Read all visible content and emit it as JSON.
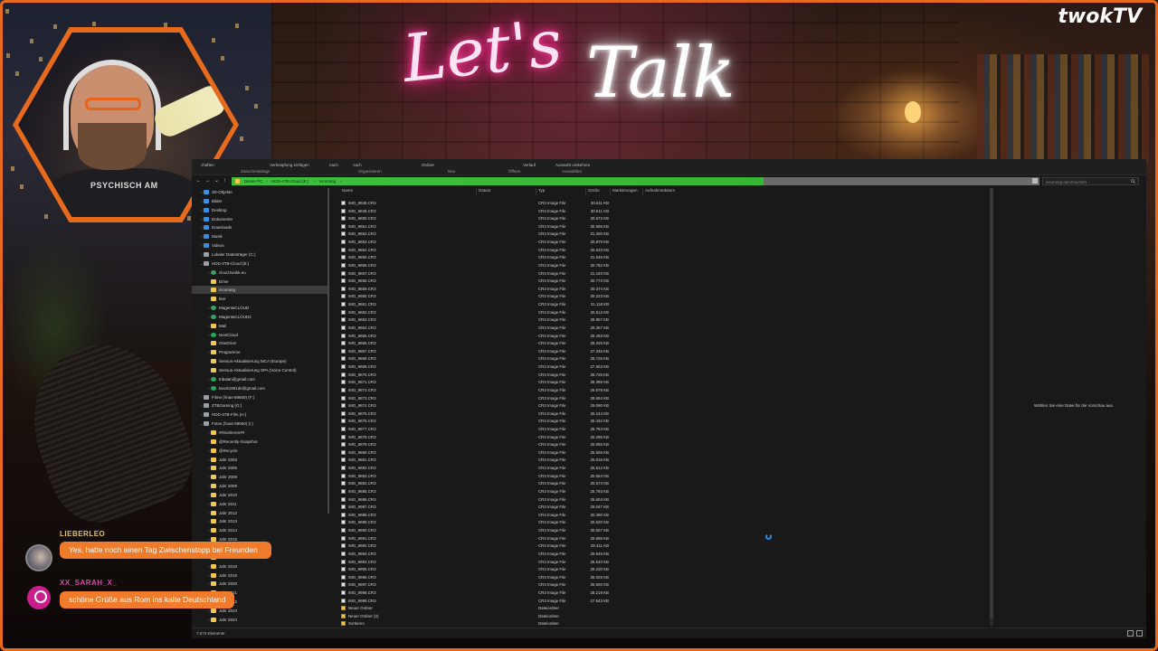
{
  "overlay": {
    "lets": "Let's",
    "talk": "Talk",
    "logo": "twokTV",
    "shirt_text": "PSYCHISCH AM"
  },
  "ribbon": {
    "items": [
      "chaften",
      "Verknüpfung einfügen",
      "nach",
      "nach",
      "Ordner",
      "Verlauf",
      "Auswahl umkehren"
    ],
    "groups": [
      "Zwischenablage",
      "Organisieren",
      "Neu",
      "Öffnen",
      "Auswählen"
    ]
  },
  "address": {
    "segments": [
      "Dieser PC",
      "HDD-4TB-Cloud (E:)",
      "incoming"
    ],
    "search_placeholder": "incoming durchsuchen"
  },
  "tree": [
    {
      "label": "3D-Objekte",
      "icon": "blue",
      "arrow": "›",
      "indent": 0
    },
    {
      "label": "Bilder",
      "icon": "blue",
      "arrow": "›",
      "indent": 0
    },
    {
      "label": "Desktop",
      "icon": "blue",
      "arrow": "›",
      "indent": 0
    },
    {
      "label": "Dokumente",
      "icon": "blue",
      "arrow": "›",
      "indent": 0
    },
    {
      "label": "Downloads",
      "icon": "blue",
      "arrow": "›",
      "indent": 0
    },
    {
      "label": "Musik",
      "icon": "blue",
      "arrow": "›",
      "indent": 0
    },
    {
      "label": "Videos",
      "icon": "blue",
      "arrow": "›",
      "indent": 0
    },
    {
      "label": "Lokaler Datenträger (C:)",
      "icon": "drive",
      "arrow": "›",
      "indent": 0
    },
    {
      "label": "HDD-4TB-Cloud (E:)",
      "icon": "drive",
      "arrow": "⌄",
      "indent": 0
    },
    {
      "label": "cloud.twokk.eu",
      "icon": "cloud",
      "arrow": "›",
      "indent": 1
    },
    {
      "label": "Drive",
      "icon": "folder",
      "arrow": "",
      "indent": 1
    },
    {
      "label": "incoming",
      "icon": "folder",
      "arrow": "",
      "indent": 1,
      "selected": true
    },
    {
      "label": "leer",
      "icon": "folder",
      "arrow": "",
      "indent": 1
    },
    {
      "label": "MagentaCLOUD",
      "icon": "cloud",
      "arrow": "›",
      "indent": 1
    },
    {
      "label": "MagentaCLOUD2",
      "icon": "cloud",
      "arrow": "›",
      "indent": 1
    },
    {
      "label": "Mail",
      "icon": "folder",
      "arrow": "›",
      "indent": 1
    },
    {
      "label": "NextCloud",
      "icon": "green",
      "arrow": "›",
      "indent": 1
    },
    {
      "label": "OneDrive",
      "icon": "folder",
      "arrow": "",
      "indent": 1
    },
    {
      "label": "Programme",
      "icon": "folder",
      "arrow": "›",
      "indent": 1
    },
    {
      "label": "Sensus-Aktualisierung MCA (Europe)",
      "icon": "folder",
      "arrow": "",
      "indent": 1
    },
    {
      "label": "Sensus-Aktualisierung SPA (Voice Control)",
      "icon": "folder",
      "arrow": "",
      "indent": 1
    },
    {
      "label": "tribalan@gmail.com",
      "icon": "green",
      "arrow": "›",
      "indent": 1
    },
    {
      "label": "tavok1981de@gmail.com",
      "icon": "green",
      "arrow": "›",
      "indent": 1
    },
    {
      "label": "Filme (\\\\nas-59650) (F:)",
      "icon": "drive",
      "arrow": "›",
      "indent": 0
    },
    {
      "label": "ZTBGaming (G:)",
      "icon": "drive",
      "arrow": "›",
      "indent": 0
    },
    {
      "label": "HDD-4TB-Film (H:)",
      "icon": "drive",
      "arrow": "›",
      "indent": 0
    },
    {
      "label": "Fotos (\\\\nas-59650) (I:)",
      "icon": "drive",
      "arrow": "⌄",
      "indent": 0
    },
    {
      "label": "##Sortieren##",
      "icon": "folder",
      "arrow": "›",
      "indent": 1
    },
    {
      "label": "@Recently-Snapshot",
      "icon": "folder",
      "arrow": "›",
      "indent": 1
    },
    {
      "label": "@Recycle",
      "icon": "folder",
      "arrow": "›",
      "indent": 1
    },
    {
      "label": "Jahr 2003",
      "icon": "folder",
      "arrow": "›",
      "indent": 1
    },
    {
      "label": "Jahr 2005",
      "icon": "folder",
      "arrow": "›",
      "indent": 1
    },
    {
      "label": "Jahr 2008",
      "icon": "folder",
      "arrow": "›",
      "indent": 1
    },
    {
      "label": "Jahr 2009",
      "icon": "folder",
      "arrow": "›",
      "indent": 1
    },
    {
      "label": "Jahr 2010",
      "icon": "folder",
      "arrow": "›",
      "indent": 1
    },
    {
      "label": "Jahr 2011",
      "icon": "folder",
      "arrow": "›",
      "indent": 1
    },
    {
      "label": "Jahr 2012",
      "icon": "folder",
      "arrow": "›",
      "indent": 1
    },
    {
      "label": "Jahr 2013",
      "icon": "folder",
      "arrow": "›",
      "indent": 1
    },
    {
      "label": "Jahr 2014",
      "icon": "folder",
      "arrow": "›",
      "indent": 1
    },
    {
      "label": "Jahr 2015",
      "icon": "folder",
      "arrow": "›",
      "indent": 1
    },
    {
      "label": "Jahr 2016",
      "icon": "folder",
      "arrow": "›",
      "indent": 1
    },
    {
      "label": "Jahr 2017",
      "icon": "folder",
      "arrow": "›",
      "indent": 1
    },
    {
      "label": "Jahr 2018",
      "icon": "folder",
      "arrow": "›",
      "indent": 1
    },
    {
      "label": "Jahr 2019",
      "icon": "folder",
      "arrow": "›",
      "indent": 1
    },
    {
      "label": "Jahr 2020",
      "icon": "folder",
      "arrow": "›",
      "indent": 1
    },
    {
      "label": "Jahr 2021",
      "icon": "folder",
      "arrow": "›",
      "indent": 1
    },
    {
      "label": "Jahr 2022",
      "icon": "folder",
      "arrow": "›",
      "indent": 1
    },
    {
      "label": "Jahr 2023",
      "icon": "folder",
      "arrow": "›",
      "indent": 1
    },
    {
      "label": "Jahr 2024",
      "icon": "folder",
      "arrow": "›",
      "indent": 1
    }
  ],
  "columns": [
    "Name",
    "Datum",
    "Typ",
    "Größe",
    "Markierungen",
    "Aufnahmedatum"
  ],
  "files": [
    {
      "name": "IMG_9848.CR3",
      "type": "CR3 Image File",
      "size": "30.511 KB"
    },
    {
      "name": "IMG_9849.CR3",
      "type": "CR3 Image File",
      "size": "30.611 KB"
    },
    {
      "name": "IMG_9850.CR3",
      "type": "CR3 Image File",
      "size": "30.573 KB"
    },
    {
      "name": "IMG_9851.CR3",
      "type": "CR3 Image File",
      "size": "30.595 KB"
    },
    {
      "name": "IMG_9852.CR3",
      "type": "CR3 Image File",
      "size": "31.250 KB"
    },
    {
      "name": "IMG_9853.CR3",
      "type": "CR3 Image File",
      "size": "30.879 KB"
    },
    {
      "name": "IMG_9854.CR3",
      "type": "CR3 Image File",
      "size": "30.633 KB"
    },
    {
      "name": "IMG_9855.CR3",
      "type": "CR3 Image File",
      "size": "31.548 KB"
    },
    {
      "name": "IMG_9856.CR3",
      "type": "CR3 Image File",
      "size": "30.782 KB"
    },
    {
      "name": "IMG_9857.CR3",
      "type": "CR3 Image File",
      "size": "31.193 KB"
    },
    {
      "name": "IMG_9858.CR3",
      "type": "CR3 Image File",
      "size": "30.773 KB"
    },
    {
      "name": "IMG_9859.CR3",
      "type": "CR3 Image File",
      "size": "30.374 KB"
    },
    {
      "name": "IMG_9860.CR3",
      "type": "CR3 Image File",
      "size": "30.223 KB"
    },
    {
      "name": "IMG_9861.CR3",
      "type": "CR3 Image File",
      "size": "31.118 KB"
    },
    {
      "name": "IMG_9862.CR3",
      "type": "CR3 Image File",
      "size": "30.513 KB"
    },
    {
      "name": "IMG_9863.CR3",
      "type": "CR3 Image File",
      "size": "28.857 KB"
    },
    {
      "name": "IMG_9864.CR3",
      "type": "CR3 Image File",
      "size": "29.367 KB"
    },
    {
      "name": "IMG_9865.CR3",
      "type": "CR3 Image File",
      "size": "28.493 KB"
    },
    {
      "name": "IMG_9866.CR3",
      "type": "CR3 Image File",
      "size": "28.345 KB"
    },
    {
      "name": "IMG_9867.CR3",
      "type": "CR3 Image File",
      "size": "27.345 KB"
    },
    {
      "name": "IMG_9868.CR3",
      "type": "CR3 Image File",
      "size": "28.725 KB"
    },
    {
      "name": "IMG_9869.CR3",
      "type": "CR3 Image File",
      "size": "27.553 KB"
    },
    {
      "name": "IMG_9870.CR3",
      "type": "CR3 Image File",
      "size": "28.726 KB"
    },
    {
      "name": "IMG_9871.CR3",
      "type": "CR3 Image File",
      "size": "28.399 KB"
    },
    {
      "name": "IMG_9872.CR3",
      "type": "CR3 Image File",
      "size": "26.678 KB"
    },
    {
      "name": "IMG_9873.CR3",
      "type": "CR3 Image File",
      "size": "28.654 KB"
    },
    {
      "name": "IMG_9874.CR3",
      "type": "CR3 Image File",
      "size": "29.090 KB"
    },
    {
      "name": "IMG_9875.CR3",
      "type": "CR3 Image File",
      "size": "28.244 KB"
    },
    {
      "name": "IMG_9876.CR3",
      "type": "CR3 Image File",
      "size": "28.432 KB"
    },
    {
      "name": "IMG_9877.CR3",
      "type": "CR3 Image File",
      "size": "25.784 KB"
    },
    {
      "name": "IMG_9878.CR3",
      "type": "CR3 Image File",
      "size": "26.295 KB"
    },
    {
      "name": "IMG_9879.CR3",
      "type": "CR3 Image File",
      "size": "26.055 KB"
    },
    {
      "name": "IMG_9880.CR3",
      "type": "CR3 Image File",
      "size": "25.608 KB"
    },
    {
      "name": "IMG_9881.CR3",
      "type": "CR3 Image File",
      "size": "26.018 KB"
    },
    {
      "name": "IMG_9882.CR3",
      "type": "CR3 Image File",
      "size": "25.612 KB"
    },
    {
      "name": "IMG_9883.CR3",
      "type": "CR3 Image File",
      "size": "25.554 KB"
    },
    {
      "name": "IMG_9884.CR3",
      "type": "CR3 Image File",
      "size": "25.574 KB"
    },
    {
      "name": "IMG_9885.CR3",
      "type": "CR3 Image File",
      "size": "25.793 KB"
    },
    {
      "name": "IMG_9886.CR3",
      "type": "CR3 Image File",
      "size": "25.604 KB"
    },
    {
      "name": "IMG_9987.CR3",
      "type": "CR3 Image File",
      "size": "29.047 KB"
    },
    {
      "name": "IMG_9988.CR3",
      "type": "CR3 Image File",
      "size": "30.490 KB"
    },
    {
      "name": "IMG_9989.CR3",
      "type": "CR3 Image File",
      "size": "29.620 KB"
    },
    {
      "name": "IMG_9990.CR3",
      "type": "CR3 Image File",
      "size": "30.557 KB"
    },
    {
      "name": "IMG_9991.CR3",
      "type": "CR3 Image File",
      "size": "29.586 KB"
    },
    {
      "name": "IMG_9992.CR3",
      "type": "CR3 Image File",
      "size": "29.411 KB"
    },
    {
      "name": "IMG_9993.CR3",
      "type": "CR3 Image File",
      "size": "29.549 KB"
    },
    {
      "name": "IMG_9994.CR3",
      "type": "CR3 Image File",
      "size": "28.540 KB"
    },
    {
      "name": "IMG_9995.CR3",
      "type": "CR3 Image File",
      "size": "28.230 KB"
    },
    {
      "name": "IMG_9996.CR3",
      "type": "CR3 Image File",
      "size": "28.029 KB"
    },
    {
      "name": "IMG_9997.CR3",
      "type": "CR3 Image File",
      "size": "28.500 KB"
    },
    {
      "name": "IMG_9998.CR3",
      "type": "CR3 Image File",
      "size": "28.219 KB"
    },
    {
      "name": "IMG_9999.CR3",
      "type": "CR3 Image File",
      "size": "27.543 KB"
    },
    {
      "name": "Neuer Ordner",
      "type": "Dateiordner",
      "size": "",
      "folder": true
    },
    {
      "name": "Neuer Ordner (2)",
      "type": "Dateiordner",
      "size": "",
      "folder": true
    },
    {
      "name": "Sortieren",
      "type": "Dateiordner",
      "size": "",
      "folder": true
    }
  ],
  "preview_text": "Wählen Sie eine Datei für die Vorschau aus.",
  "status": "7.673 Elemente",
  "chat": [
    {
      "user": "LIEBERLEO",
      "message": "Yes, hatte noch einen Tag Zwischenstopp bei Freunden",
      "color": "#d9c27a"
    },
    {
      "user": "XX_SARAH_X_",
      "message": "schöne Grüße aus Rom ins kalte Deutschland",
      "color": "#d84aa6"
    }
  ],
  "colors": {
    "accent": "#e86a1c",
    "address_green": "#3fbf3f",
    "chat_bubble": "#f07b2a"
  }
}
